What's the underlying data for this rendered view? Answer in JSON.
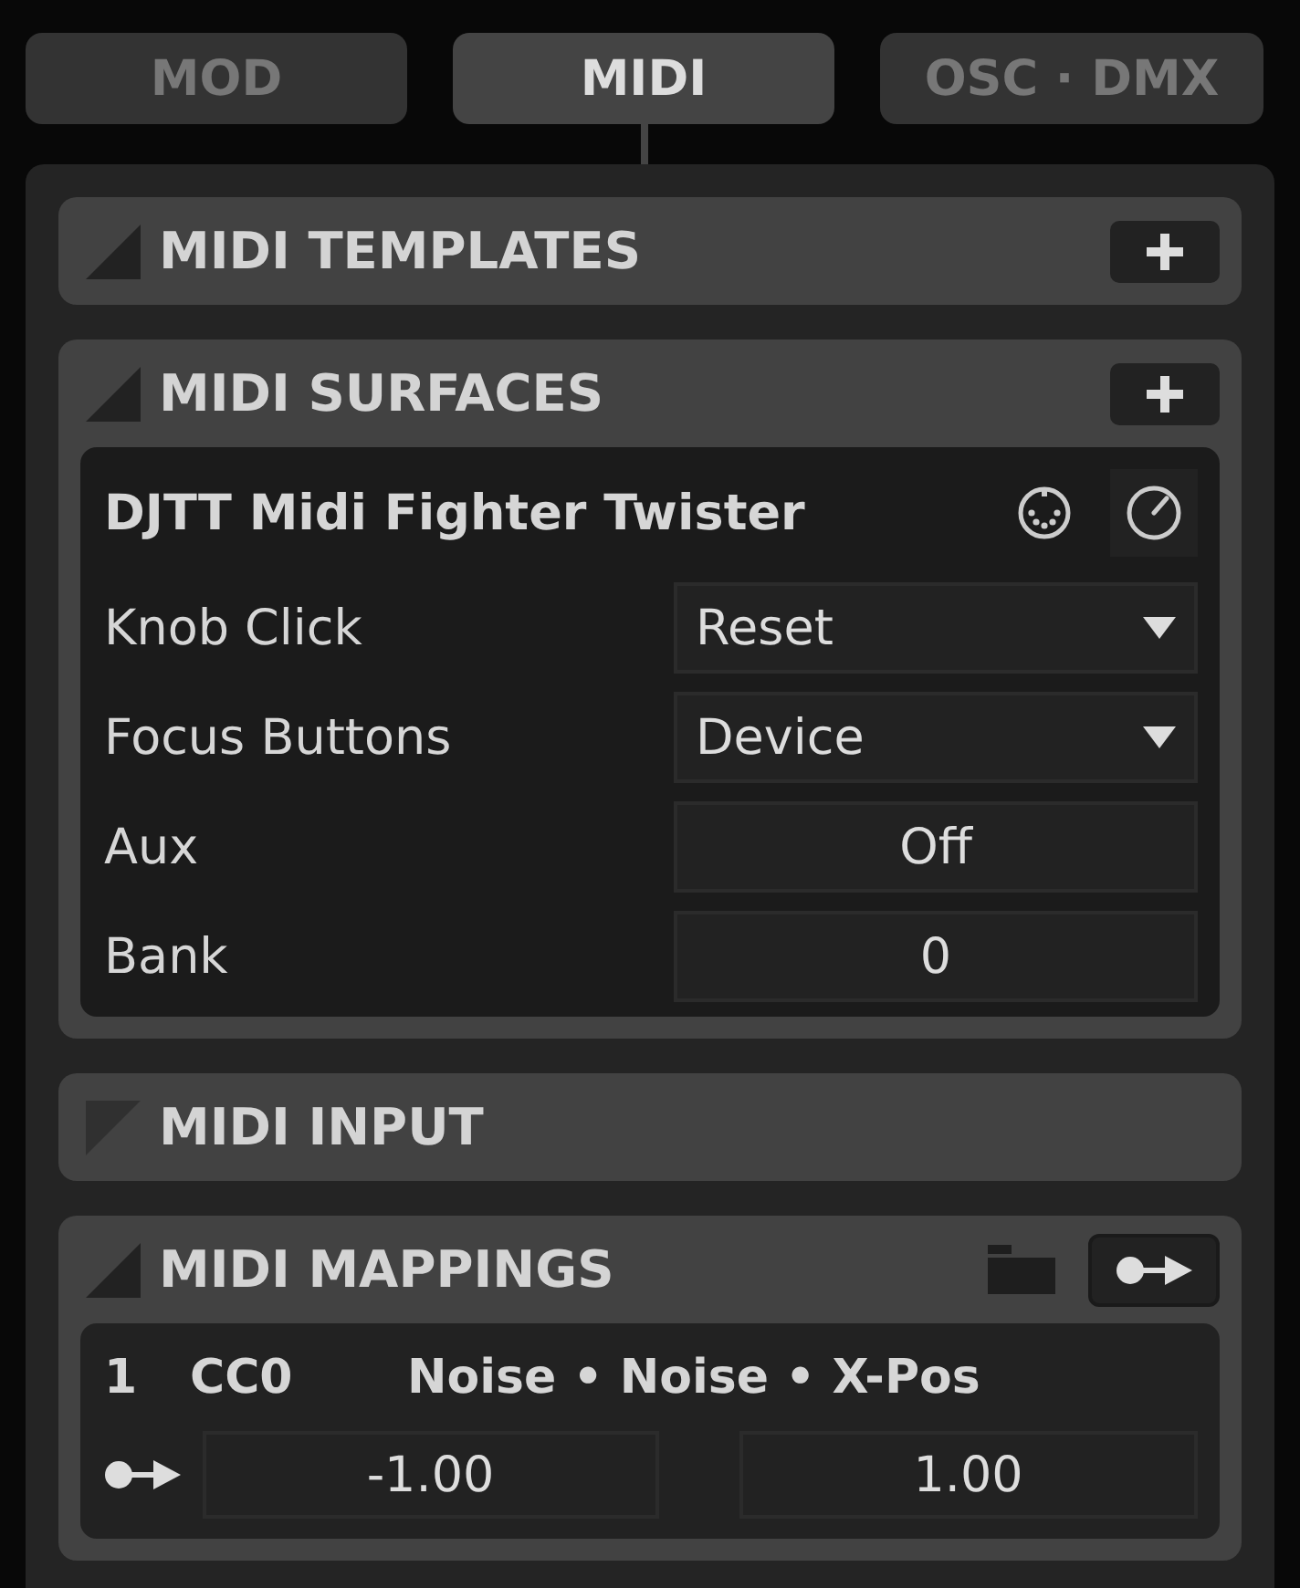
{
  "tabs": [
    {
      "label": "MOD",
      "selected": false
    },
    {
      "label": "MIDI",
      "selected": true
    },
    {
      "label": "OSC · DMX",
      "selected": false
    }
  ],
  "sections": [
    {
      "kind": "templates",
      "title": "MIDI TEMPLATES",
      "expanded": true
    },
    {
      "kind": "surfaces",
      "title": "MIDI SURFACES",
      "expanded": true,
      "devices": [
        {
          "name": "DJTT Midi Fighter Twister",
          "settings": [
            {
              "kind": "dropdown",
              "label": "Knob Click",
              "value": "Reset"
            },
            {
              "kind": "dropdown",
              "label": "Focus Buttons",
              "value": "Device"
            },
            {
              "kind": "field",
              "label": "Aux",
              "value": "Off"
            },
            {
              "kind": "field",
              "label": "Bank",
              "value": "0"
            }
          ]
        }
      ]
    },
    {
      "kind": "input",
      "title": "MIDI INPUT",
      "expanded": false
    },
    {
      "kind": "mappings",
      "title": "MIDI MAPPINGS",
      "expanded": true,
      "mappings": [
        {
          "index": "1",
          "control": "CC0",
          "target": "Noise • Noise • X-Pos",
          "min": "-1.00",
          "max": "1.00"
        }
      ]
    }
  ]
}
